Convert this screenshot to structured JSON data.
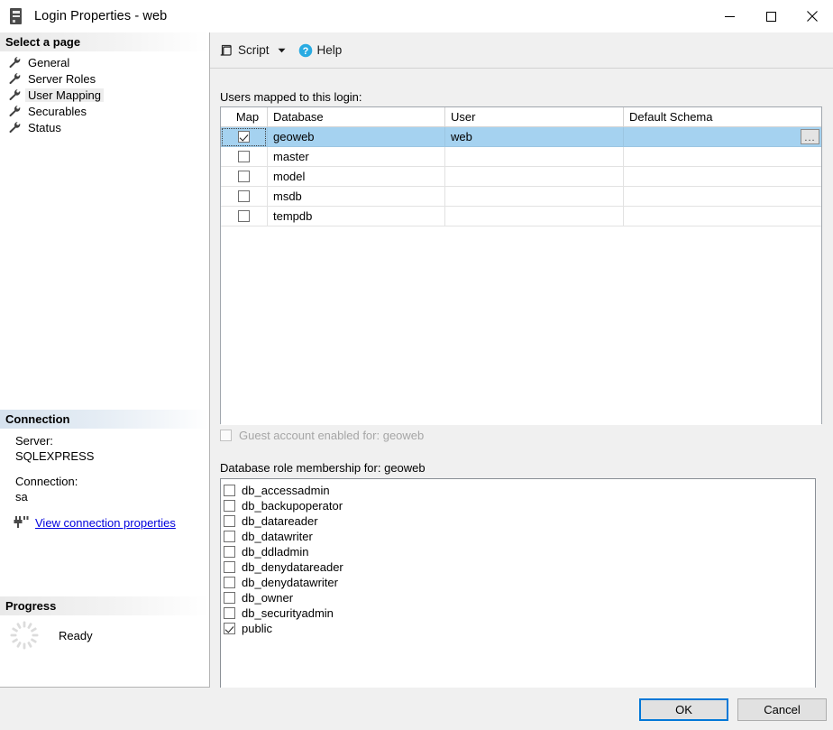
{
  "window": {
    "title": "Login Properties - web",
    "icon": "server-tower-icon",
    "controls": {
      "minimize": "minimize-icon",
      "maximize": "maximize-icon",
      "close": "close-icon"
    }
  },
  "sidebar": {
    "select_page_header": "Select a page",
    "pages": [
      {
        "label": "General",
        "selected": false
      },
      {
        "label": "Server Roles",
        "selected": false
      },
      {
        "label": "User Mapping",
        "selected": true
      },
      {
        "label": "Securables",
        "selected": false
      },
      {
        "label": "Status",
        "selected": false
      }
    ],
    "connection": {
      "header": "Connection",
      "server_label": "Server:",
      "server_value": "SQLEXPRESS",
      "connection_label": "Connection:",
      "connection_value": "sa",
      "link": "View connection properties",
      "link_color": "#0000dd"
    },
    "progress": {
      "header": "Progress",
      "status": "Ready"
    }
  },
  "toolbar": {
    "script_label": "Script",
    "script_icon": "script-icon",
    "dropdown_icon": "chevron-down-icon",
    "help_label": "Help",
    "help_icon": "help-circle-icon",
    "help_icon_color": "#29abe2"
  },
  "main": {
    "users_label": "Users mapped to this login:",
    "grid": {
      "columns": [
        "Map",
        "Database",
        "User",
        "Default Schema"
      ],
      "rows": [
        {
          "map": true,
          "database": "geoweb",
          "user": "web",
          "schema": "",
          "selected": true,
          "has_browse_button": true
        },
        {
          "map": false,
          "database": "master",
          "user": "",
          "schema": "",
          "selected": false,
          "has_browse_button": false
        },
        {
          "map": false,
          "database": "model",
          "user": "",
          "schema": "",
          "selected": false,
          "has_browse_button": false
        },
        {
          "map": false,
          "database": "msdb",
          "user": "",
          "schema": "",
          "selected": false,
          "has_browse_button": false
        },
        {
          "map": false,
          "database": "tempdb",
          "user": "",
          "schema": "",
          "selected": false,
          "has_browse_button": false
        }
      ],
      "selection_color": "#a5d2f0",
      "browse_button_label": "..."
    },
    "guest_account": {
      "label": "Guest account enabled for: geoweb",
      "checked": false,
      "disabled": true
    },
    "roles_label": "Database role membership for: geoweb",
    "roles": [
      {
        "label": "db_accessadmin",
        "checked": false
      },
      {
        "label": "db_backupoperator",
        "checked": false
      },
      {
        "label": "db_datareader",
        "checked": false
      },
      {
        "label": "db_datawriter",
        "checked": false
      },
      {
        "label": "db_ddladmin",
        "checked": false
      },
      {
        "label": "db_denydatareader",
        "checked": false
      },
      {
        "label": "db_denydatawriter",
        "checked": false
      },
      {
        "label": "db_owner",
        "checked": false
      },
      {
        "label": "db_securityadmin",
        "checked": false
      },
      {
        "label": "public",
        "checked": true
      }
    ]
  },
  "footer": {
    "ok_label": "OK",
    "cancel_label": "Cancel",
    "focus_color": "#0078d7"
  }
}
